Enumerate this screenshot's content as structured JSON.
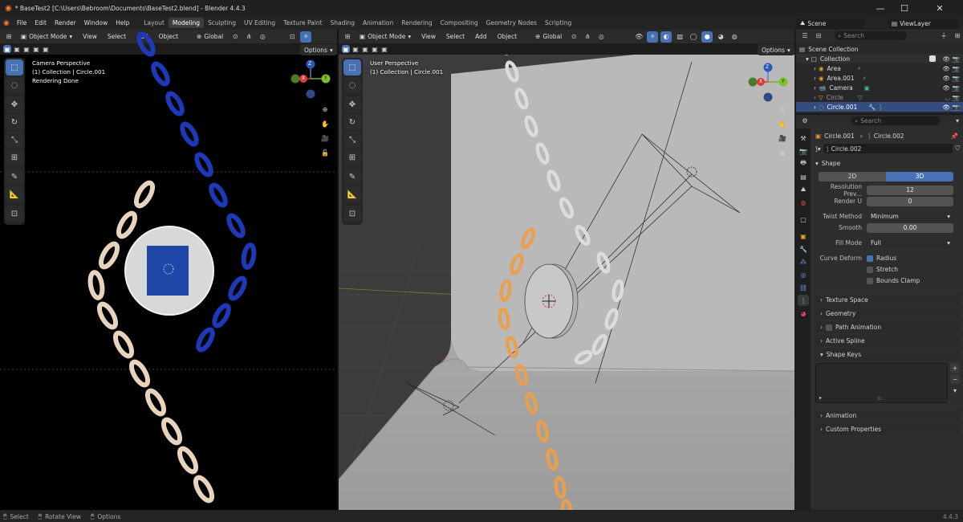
{
  "window": {
    "title": "* BaseTest2 [C:\\Users\\Bebroom\\Documents\\BaseTest2.blend] - Blender 4.4.3",
    "minimize": "—",
    "maximize": "☐",
    "close": "✕"
  },
  "menu": [
    "File",
    "Edit",
    "Render",
    "Window",
    "Help"
  ],
  "workspaces": [
    "Layout",
    "Modeling",
    "Sculpting",
    "UV Editing",
    "Texture Paint",
    "Shading",
    "Animation",
    "Rendering",
    "Compositing",
    "Geometry Nodes",
    "Scripting"
  ],
  "active_workspace": "Modeling",
  "scene": {
    "name": "Scene",
    "view_layer": "ViewLayer"
  },
  "viewport_left": {
    "mode": "Object Mode",
    "menus": [
      "View",
      "Select",
      "Add",
      "Object"
    ],
    "orientation": "Global",
    "options": "Options",
    "overlay": [
      "Camera Perspective",
      "(1) Collection | Circle.001",
      "Rendering Done"
    ],
    "gizmo": {
      "x": "X",
      "y": "Y",
      "z": "Z"
    }
  },
  "viewport_right": {
    "mode": "Object Mode",
    "menus": [
      "View",
      "Select",
      "Add",
      "Object"
    ],
    "orientation": "Global",
    "options": "Options",
    "overlay": [
      "User Perspective",
      "(1) Collection | Circle.001"
    ],
    "gizmo": {
      "x": "X",
      "y": "Y",
      "z": "Z"
    }
  },
  "outliner": {
    "search_placeholder": "Search",
    "root": "Scene Collection",
    "collection": "Collection",
    "items": [
      "Area",
      "Area.001",
      "Camera",
      "Circle",
      "Circle.001"
    ]
  },
  "properties": {
    "search_placeholder": "Search",
    "breadcrumb_object": "Circle.001",
    "breadcrumb_data": "Circle.002",
    "datablock": "Circle.002",
    "shape_title": "Shape",
    "dim_2d": "2D",
    "dim_3d": "3D",
    "resolution_label": "Resolution Prev...",
    "resolution_value": "12",
    "render_u_label": "Render U",
    "render_u_value": "0",
    "twist_label": "Twist Method",
    "twist_value": "Minimum",
    "smooth_label": "Smooth",
    "smooth_value": "0.00",
    "fill_label": "Fill Mode",
    "fill_value": "Full",
    "curve_deform_label": "Curve Deform",
    "radius_label": "Radius",
    "stretch_label": "Stretch",
    "bounds_label": "Bounds Clamp",
    "panels": [
      "Texture Space",
      "Geometry",
      "Path Animation",
      "Active Spline",
      "Shape Keys"
    ],
    "panels_bottom": [
      "Animation",
      "Custom Properties"
    ]
  },
  "statusbar": {
    "select": "Select",
    "rotate": "Rotate View",
    "options": "Options",
    "version": "4.4.3"
  }
}
